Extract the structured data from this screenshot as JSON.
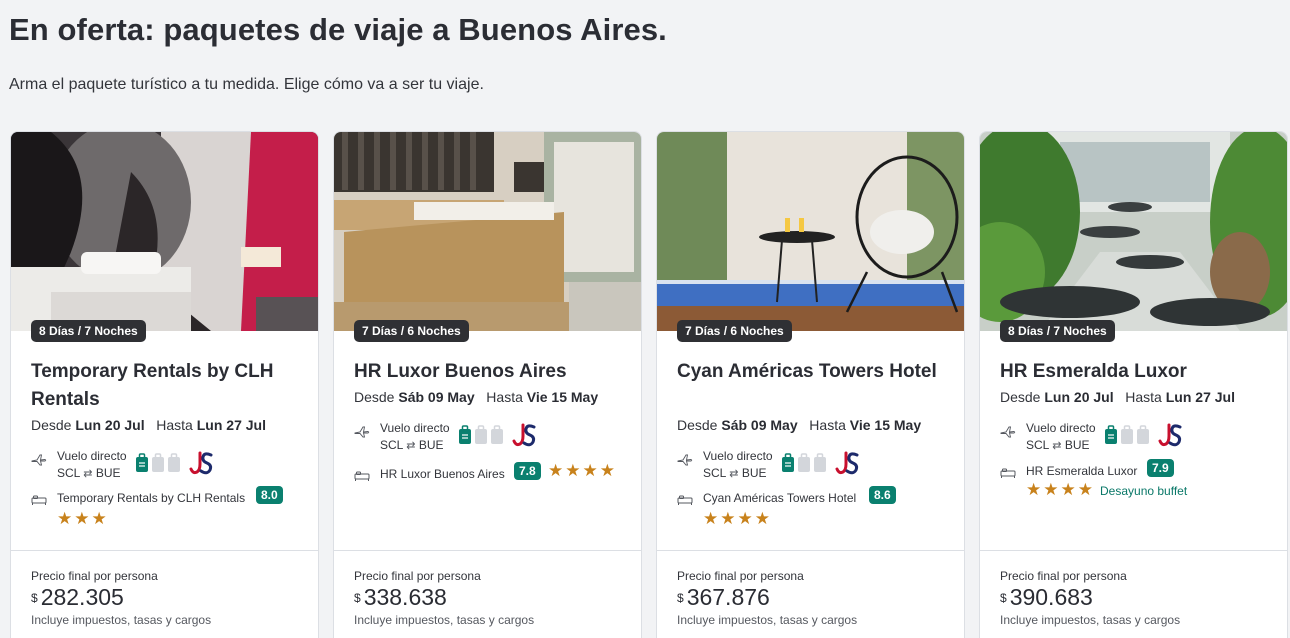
{
  "header": {
    "title": "En oferta: paquetes de viaje a Buenos Aires.",
    "subtitle": "Arma el paquete turístico a tu medida. Elige cómo va a ser tu viaje."
  },
  "labels": {
    "desde": "Desde",
    "hasta": "Hasta",
    "price_label": "Precio final por persona",
    "currency": "$",
    "price_note": "Incluye impuestos, tasas y cargos",
    "flight_type": "Vuelo directo",
    "origin": "SCL",
    "destination": "BUE",
    "swap_glyph": "⇄"
  },
  "colors": {
    "rating_bg": "#0a806f",
    "star": "#c8821c",
    "badge_bg": "#2f3034",
    "amenity": "#0a7868"
  },
  "icons": {
    "plane": "plane-icon",
    "bed": "bed-icon",
    "luggage": "luggage-icon",
    "airline": "jetsmart-logo"
  },
  "cards": [
    {
      "duration": "8 Días / 7 Noches",
      "name": "Temporary Rentals by CLH Rentals",
      "from_date": "Lun 20 Jul",
      "to_date": "Lun 27 Jul",
      "hotel_line": "Temporary Rentals by CLH Rentals",
      "rating": "8.0",
      "stars": "★★★",
      "price": "282.305"
    },
    {
      "duration": "7 Días / 6 Noches",
      "name": "HR Luxor Buenos Aires",
      "from_date": "Sáb 09 May",
      "to_date": "Vie 15 May",
      "hotel_line": "HR Luxor Buenos Aires",
      "rating": "7.8",
      "stars": "★★★★",
      "price": "338.638"
    },
    {
      "duration": "7 Días / 6 Noches",
      "name": "Cyan Américas Towers Hotel",
      "from_date": "Sáb 09 May",
      "to_date": "Vie 15 May",
      "hotel_line": "Cyan Américas Towers Hotel",
      "rating": "8.6",
      "stars": "★★★★",
      "price": "367.876"
    },
    {
      "duration": "8 Días / 7 Noches",
      "name": "HR Esmeralda Luxor",
      "from_date": "Lun 20 Jul",
      "to_date": "Lun 27 Jul",
      "hotel_line": "HR Esmeralda Luxor",
      "rating": "7.9",
      "stars": "★★★★",
      "amenity": "Desayuno buffet",
      "price": "390.683"
    }
  ]
}
